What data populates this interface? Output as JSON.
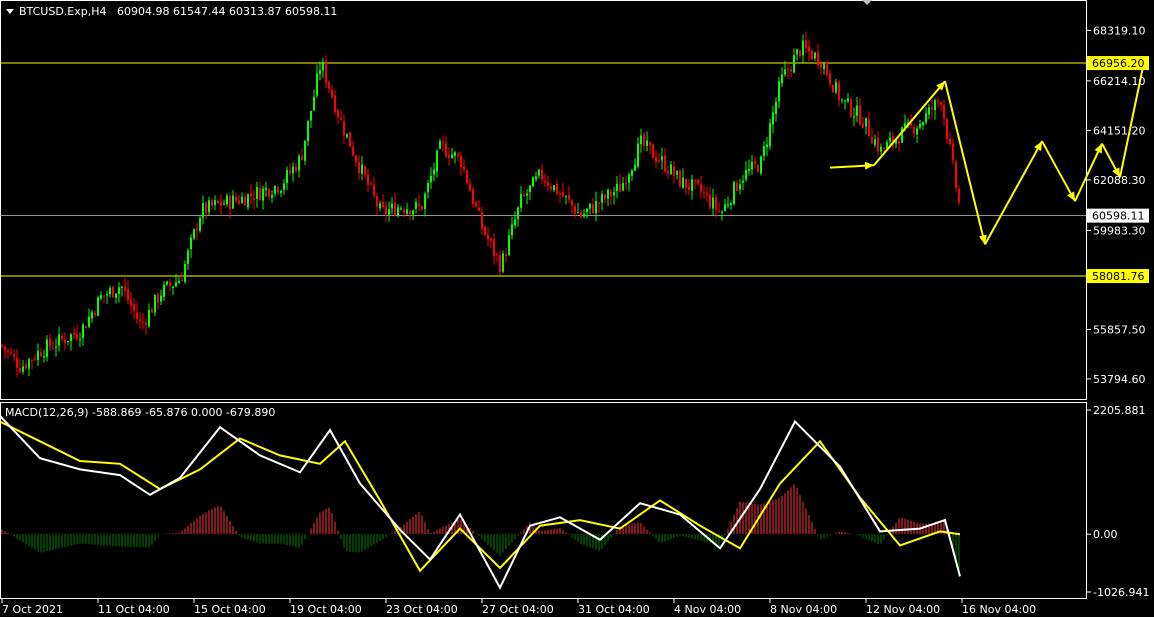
{
  "header": {
    "symbol_label": "BTCUSD.Exp,H4",
    "ohlc_text": "60904.98 61547.44 60313.87 60598.11"
  },
  "macd": {
    "label": "MACD(12,26,9) -588.869 -65.876 0.000 -679.890"
  },
  "colors": {
    "background": "#000000",
    "bull_candle": "#00ff00",
    "bear_candle": "#ff0000",
    "level_line": "#ffff00",
    "hist_up": "#ff3333",
    "hist_down": "#008000",
    "macd_line": "#ffffff",
    "signal_line": "#ffff00"
  },
  "chart_data": [
    {
      "type": "candlestick",
      "title": "BTCUSD.Exp,H4",
      "y_ticks": [
        "68319.10",
        "66214.10",
        "64151.20",
        "62088.30",
        "59983.30",
        "55857.50",
        "53794.60"
      ],
      "ylim": [
        53000,
        69500
      ],
      "levels": [
        {
          "label": "66956.20",
          "price": 66956.2
        },
        {
          "label": "58081.76",
          "price": 58081.76
        }
      ],
      "current_price": {
        "label": "60598.11",
        "price": 60598.11
      },
      "x_ticks": [
        "7 Oct 2021",
        "11 Oct 04:00",
        "15 Oct 04:00",
        "19 Oct 04:00",
        "23 Oct 04:00",
        "27 Oct 04:00",
        "31 Oct 04:00",
        "4 Nov 04:00",
        "8 Nov 04:00",
        "12 Nov 04:00",
        "16 Nov 04:00"
      ],
      "close_path": [
        [
          0,
          55200
        ],
        [
          20,
          54300
        ],
        [
          40,
          55000
        ],
        [
          60,
          55400
        ],
        [
          80,
          55800
        ],
        [
          100,
          57200
        ],
        [
          120,
          57700
        ],
        [
          140,
          56000
        ],
        [
          160,
          57400
        ],
        [
          180,
          58000
        ],
        [
          200,
          60800
        ],
        [
          220,
          61100
        ],
        [
          240,
          61300
        ],
        [
          260,
          61600
        ],
        [
          280,
          61900
        ],
        [
          300,
          63000
        ],
        [
          320,
          67000
        ],
        [
          340,
          64500
        ],
        [
          360,
          62500
        ],
        [
          380,
          60700
        ],
        [
          400,
          61000
        ],
        [
          420,
          60900
        ],
        [
          440,
          63500
        ],
        [
          460,
          62900
        ],
        [
          480,
          60200
        ],
        [
          500,
          58500
        ],
        [
          520,
          61200
        ],
        [
          540,
          62300
        ],
        [
          560,
          61500
        ],
        [
          580,
          60600
        ],
        [
          600,
          61200
        ],
        [
          620,
          61800
        ],
        [
          640,
          63600
        ],
        [
          660,
          62900
        ],
        [
          680,
          62000
        ],
        [
          700,
          61600
        ],
        [
          720,
          60700
        ],
        [
          740,
          62200
        ],
        [
          760,
          62800
        ],
        [
          780,
          66200
        ],
        [
          800,
          67600
        ],
        [
          820,
          67100
        ],
        [
          840,
          65400
        ],
        [
          860,
          64700
        ],
        [
          880,
          63300
        ],
        [
          900,
          64000
        ],
        [
          920,
          64500
        ],
        [
          940,
          65500
        ],
        [
          960,
          60600
        ]
      ],
      "forecast_arrows": [
        {
          "from": [
            62600,
            830
          ],
          "to": [
            62700,
            874
          ]
        },
        {
          "from": [
            62700,
            874
          ],
          "to": [
            66200,
            945
          ]
        },
        {
          "from": [
            66200,
            945
          ],
          "to": [
            59400,
            985
          ]
        },
        {
          "from": [
            59400,
            985
          ],
          "to": [
            63700,
            1042
          ]
        },
        {
          "from": [
            63700,
            1042
          ],
          "to": [
            61200,
            1075
          ]
        },
        {
          "from": [
            61200,
            1075
          ],
          "to": [
            63600,
            1102
          ]
        },
        {
          "from": [
            63600,
            1102
          ],
          "to": [
            62200,
            1120
          ]
        },
        {
          "from": [
            62200,
            1120
          ],
          "to": [
            67200,
            1145
          ]
        }
      ]
    },
    {
      "type": "macd",
      "title": "MACD(12,26,9)",
      "y_ticks": [
        "2205.881",
        "0.00",
        "-1026.941"
      ],
      "ylim": [
        -1026.941,
        2205.881
      ],
      "macd_line": [
        [
          0,
          2100
        ],
        [
          40,
          1350
        ],
        [
          80,
          1150
        ],
        [
          120,
          1050
        ],
        [
          150,
          700
        ],
        [
          180,
          1000
        ],
        [
          220,
          1900
        ],
        [
          260,
          1400
        ],
        [
          300,
          1100
        ],
        [
          330,
          1850
        ],
        [
          360,
          900
        ],
        [
          400,
          80
        ],
        [
          430,
          -450
        ],
        [
          460,
          350
        ],
        [
          500,
          -950
        ],
        [
          530,
          150
        ],
        [
          560,
          300
        ],
        [
          600,
          -100
        ],
        [
          640,
          550
        ],
        [
          680,
          350
        ],
        [
          720,
          -250
        ],
        [
          760,
          800
        ],
        [
          795,
          2000
        ],
        [
          840,
          1200
        ],
        [
          880,
          50
        ],
        [
          920,
          100
        ],
        [
          945,
          250
        ],
        [
          960,
          -750
        ]
      ],
      "signal_line": [
        [
          0,
          2000
        ],
        [
          40,
          1650
        ],
        [
          80,
          1300
        ],
        [
          120,
          1250
        ],
        [
          160,
          800
        ],
        [
          200,
          1150
        ],
        [
          240,
          1700
        ],
        [
          280,
          1400
        ],
        [
          320,
          1250
        ],
        [
          345,
          1650
        ],
        [
          380,
          600
        ],
        [
          420,
          -650
        ],
        [
          460,
          100
        ],
        [
          500,
          -600
        ],
        [
          540,
          150
        ],
        [
          580,
          250
        ],
        [
          620,
          100
        ],
        [
          660,
          600
        ],
        [
          700,
          150
        ],
        [
          740,
          -250
        ],
        [
          780,
          900
        ],
        [
          820,
          1650
        ],
        [
          860,
          650
        ],
        [
          900,
          -200
        ],
        [
          940,
          50
        ],
        [
          960,
          0
        ]
      ]
    }
  ]
}
